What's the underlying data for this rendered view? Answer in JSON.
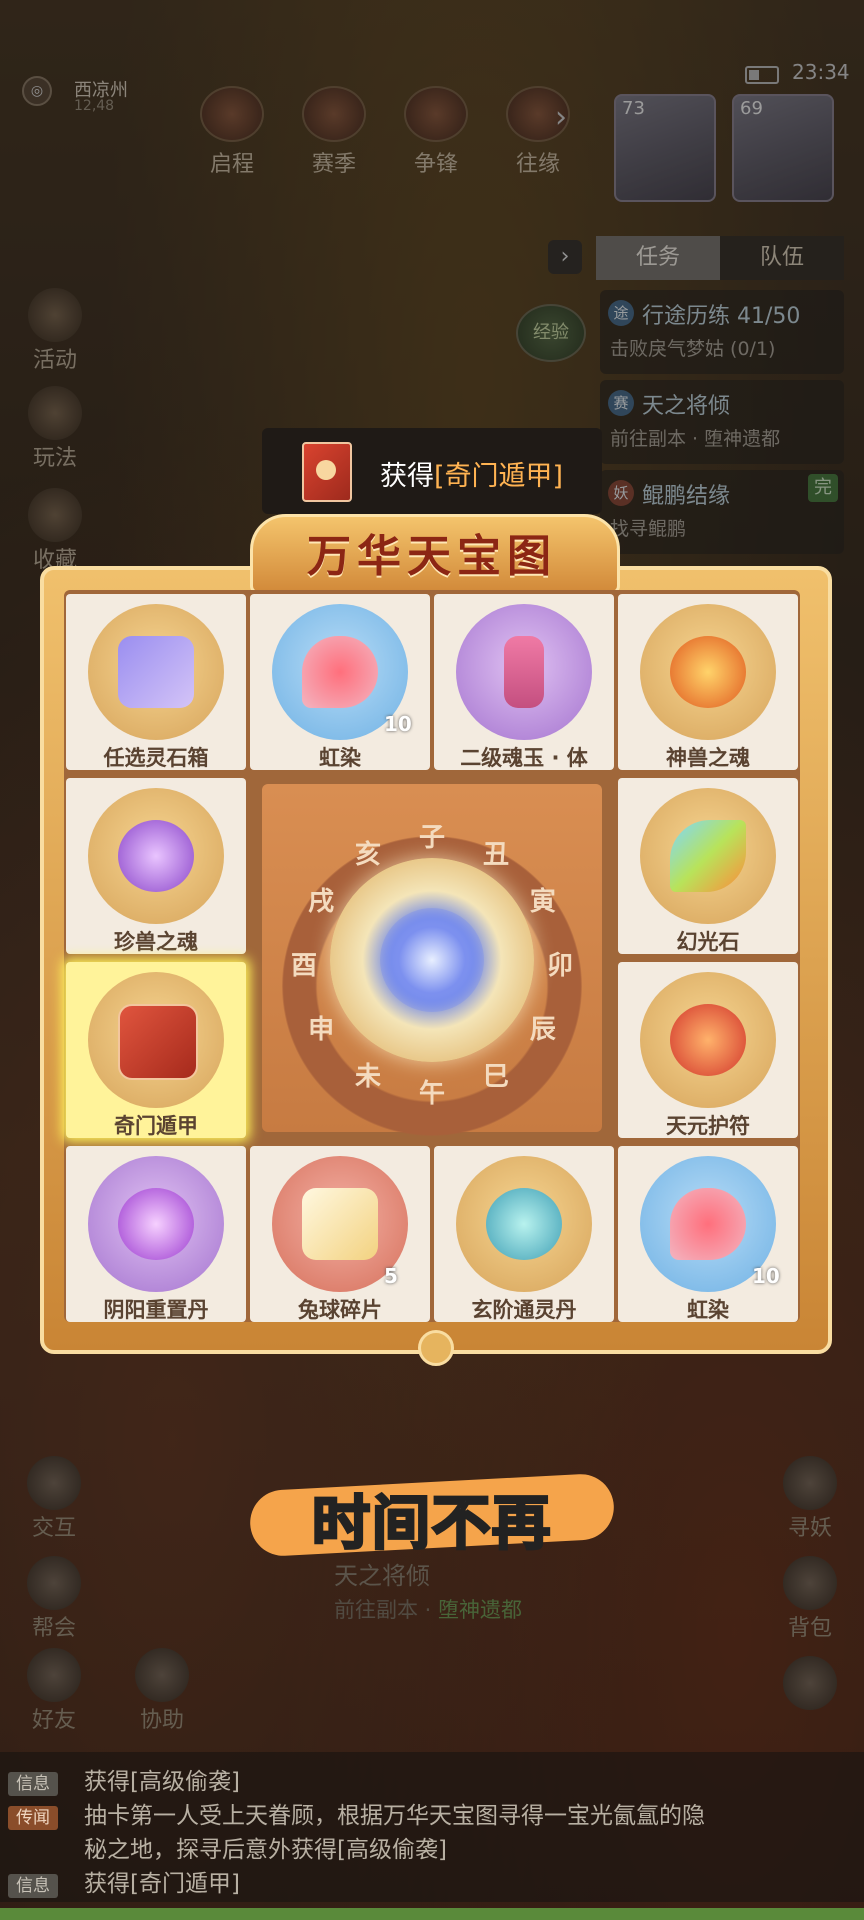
{
  "status": {
    "time": "23:34"
  },
  "location": {
    "name": "西凉州",
    "coord": "12,48"
  },
  "top_nav": [
    {
      "label": "启程"
    },
    {
      "label": "赛季"
    },
    {
      "label": "争锋"
    },
    {
      "label": "往缘"
    }
  ],
  "avatars": [
    {
      "level": "73"
    },
    {
      "level": "69"
    }
  ],
  "task_panel": {
    "tabs": [
      "任务",
      "队伍"
    ],
    "exp_label": "经验",
    "tasks": [
      {
        "badge": "途",
        "title": "行途历练 41/50",
        "sub": "击败戾气梦姑 (0/1)"
      },
      {
        "badge": "赛",
        "title": "天之将倾",
        "sub": "前往副本 · 堕神遗都"
      },
      {
        "badge": "妖",
        "title": "鲲鹏结缘",
        "sub": "找寻鲲鹏"
      }
    ],
    "done_label": "完"
  },
  "left_sidebar": [
    "活动",
    "玩法",
    "收藏"
  ],
  "reward_banner": {
    "prefix": "获得",
    "item": "[奇门遁甲]"
  },
  "board": {
    "title": "万华天宝图",
    "items": [
      {
        "name": "任选灵石箱",
        "count": "",
        "color": "gold",
        "icon": "gift-box-icon"
      },
      {
        "name": "虹染",
        "count": "10",
        "color": "blue",
        "icon": "dye-icon"
      },
      {
        "name": "二级魂玉 · 体",
        "count": "",
        "color": "purple",
        "icon": "soul-jade-icon"
      },
      {
        "name": "神兽之魂",
        "count": "",
        "color": "gold",
        "icon": "beast-soul-icon"
      },
      {
        "name": "珍兽之魂",
        "count": "",
        "color": "gold",
        "icon": "crystal-ball-icon"
      },
      {
        "name": "幻光石",
        "count": "",
        "color": "gold",
        "icon": "gem-icon"
      },
      {
        "name": "奇门遁甲",
        "count": "",
        "color": "gold",
        "icon": "book-icon",
        "selected": true
      },
      {
        "name": "天元护符",
        "count": "",
        "color": "gold",
        "icon": "amulet-icon"
      },
      {
        "name": "阴阳重置丹",
        "count": "",
        "color": "purple",
        "icon": "orb-icon"
      },
      {
        "name": "兔球碎片",
        "count": "5",
        "color": "red",
        "icon": "rabbit-puzzle-icon"
      },
      {
        "name": "玄阶通灵丹",
        "count": "",
        "color": "gold",
        "icon": "pill-icon"
      },
      {
        "name": "虹染",
        "count": "10",
        "color": "blue",
        "icon": "dye-icon"
      }
    ],
    "dial_characters": [
      "子",
      "丑",
      "寅",
      "卯",
      "辰",
      "巳",
      "午",
      "未",
      "申",
      "酉",
      "戌",
      "亥"
    ]
  },
  "caption": "时间不再",
  "bottom_left": [
    "交互",
    "帮会",
    "好友",
    "协助"
  ],
  "bottom_right": [
    "寻妖",
    "背包"
  ],
  "bottom_quest": {
    "title": "天之将倾",
    "sub_prefix": "前往副本 · ",
    "sub_place": "堕神遗都"
  },
  "chat": [
    {
      "tag": "信息",
      "text": "获得[高级偷袭]"
    },
    {
      "tag": "传闻",
      "line1": "抽卡第一人受上天眷顾，根据万华天宝图寻得一宝光氤氲的隐",
      "line2": "秘之地，探寻后意外获得[高级偷袭]"
    },
    {
      "tag": "信息",
      "text_prefix": "获得",
      "text_item": "[奇门遁甲]"
    }
  ]
}
